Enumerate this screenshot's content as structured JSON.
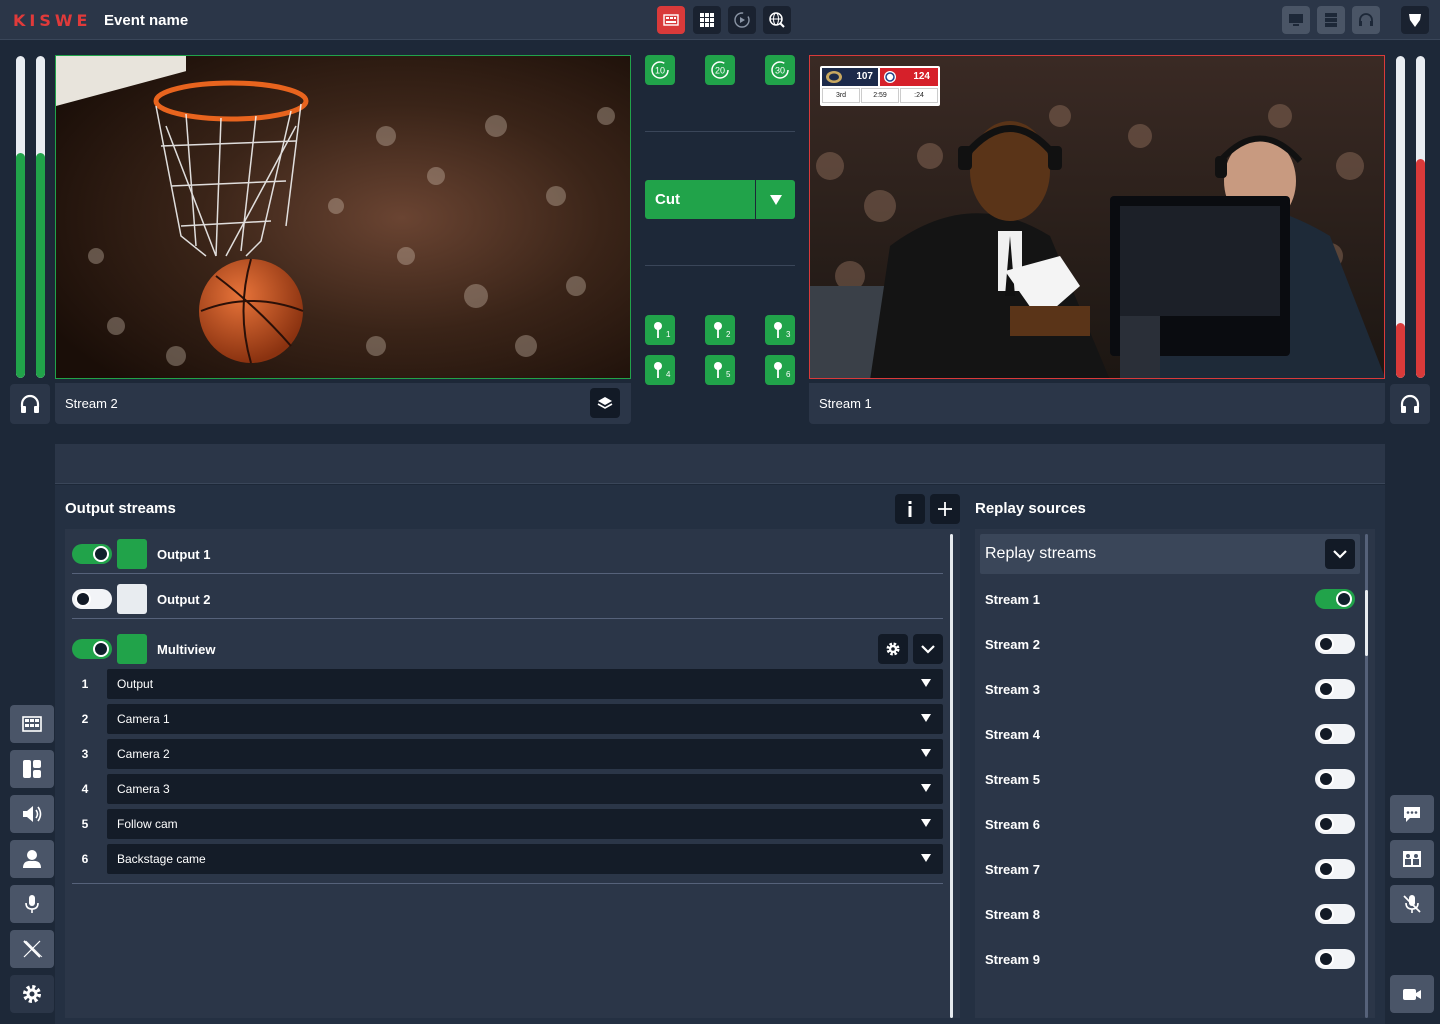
{
  "header": {
    "logo": "KISWE",
    "event_name": "Event name"
  },
  "left_monitor": {
    "stream_label": "Stream 2",
    "border_color": "#21a34a",
    "audio_level": 0.7
  },
  "right_monitor": {
    "stream_label": "Stream 1",
    "border_color": "#d93a3a",
    "audio_level": 0.68,
    "scoreboard": {
      "home_score": "107",
      "away_score": "124",
      "period": "3rd",
      "clock": "2:59",
      "shot_clock": ":24"
    }
  },
  "controls": {
    "rewind_buttons": [
      "10",
      "20",
      "30"
    ],
    "cut_label": "Cut",
    "marker_buttons": [
      "1",
      "2",
      "3",
      "4",
      "5",
      "6"
    ]
  },
  "output_streams": {
    "title": "Output streams",
    "rows": [
      {
        "label": "Output 1",
        "enabled": true,
        "swatch": "#21a34a"
      },
      {
        "label": "Output 2",
        "enabled": false,
        "swatch": "#e8ecf0"
      },
      {
        "label": "Multiview",
        "enabled": true,
        "swatch": "#21a34a"
      }
    ],
    "multiview_slots": [
      {
        "num": "1",
        "value": "Output"
      },
      {
        "num": "2",
        "value": "Camera 1"
      },
      {
        "num": "3",
        "value": "Camera 2"
      },
      {
        "num": "4",
        "value": "Camera 3"
      },
      {
        "num": "5",
        "value": "Follow cam"
      },
      {
        "num": "6",
        "value": "Backstage came"
      }
    ]
  },
  "replay_sources": {
    "title": "Replay sources",
    "dropdown_label": "Replay streams",
    "streams": [
      {
        "label": "Stream 1",
        "enabled": true
      },
      {
        "label": "Stream 2",
        "enabled": false
      },
      {
        "label": "Stream 3",
        "enabled": false
      },
      {
        "label": "Stream 4",
        "enabled": false
      },
      {
        "label": "Stream 5",
        "enabled": false
      },
      {
        "label": "Stream 6",
        "enabled": false
      },
      {
        "label": "Stream 7",
        "enabled": false
      },
      {
        "label": "Stream 8",
        "enabled": false
      },
      {
        "label": "Stream 9",
        "enabled": false
      }
    ]
  },
  "left_sidebar_icons": [
    "multiview-icon",
    "layout-icon",
    "speaker-icon",
    "user-icon",
    "microphone-icon",
    "x-logo-icon",
    "gear-icon"
  ],
  "right_sidebar_icons": [
    "chat-icon",
    "team-icon",
    "mic-off-icon",
    "camera-icon"
  ]
}
